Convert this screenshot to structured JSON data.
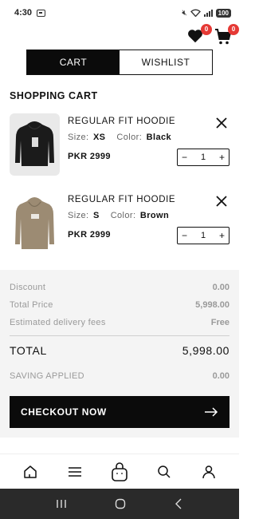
{
  "status_bar": {
    "time": "4:30",
    "battery": "100"
  },
  "header": {
    "wishlist_badge": "0",
    "cart_badge": "0"
  },
  "toggle": {
    "cart_label": "CART",
    "wishlist_label": "WISHLIST"
  },
  "section_title": "SHOPPING CART",
  "items": [
    {
      "name": "REGULAR FIT HOODIE",
      "size_label": "Size:",
      "size": "XS",
      "color_label": "Color:",
      "color": "Black",
      "price": "PKR 2999",
      "quantity": "1",
      "hoodie_color": "#1b1b1b"
    },
    {
      "name": "REGULAR FIT HOODIE",
      "size_label": "Size:",
      "size": "S",
      "color_label": "Color:",
      "color": "Brown",
      "price": "PKR 2999",
      "quantity": "1",
      "hoodie_color": "#9c8b73"
    }
  ],
  "summary": {
    "discount_label": "Discount",
    "discount": "0.00",
    "total_price_label": "Total Price",
    "total_price": "5,998.00",
    "delivery_label": "Estimated delivery fees",
    "delivery": "Free",
    "total_label": "TOTAL",
    "total": "5,998.00",
    "saving_label": "SAVING APPLIED",
    "saving": "0.00"
  },
  "checkout_label": "CHECKOUT NOW",
  "bottom_nav": [
    "home-icon",
    "menu-icon",
    "bag-icon",
    "search-icon",
    "profile-icon"
  ]
}
